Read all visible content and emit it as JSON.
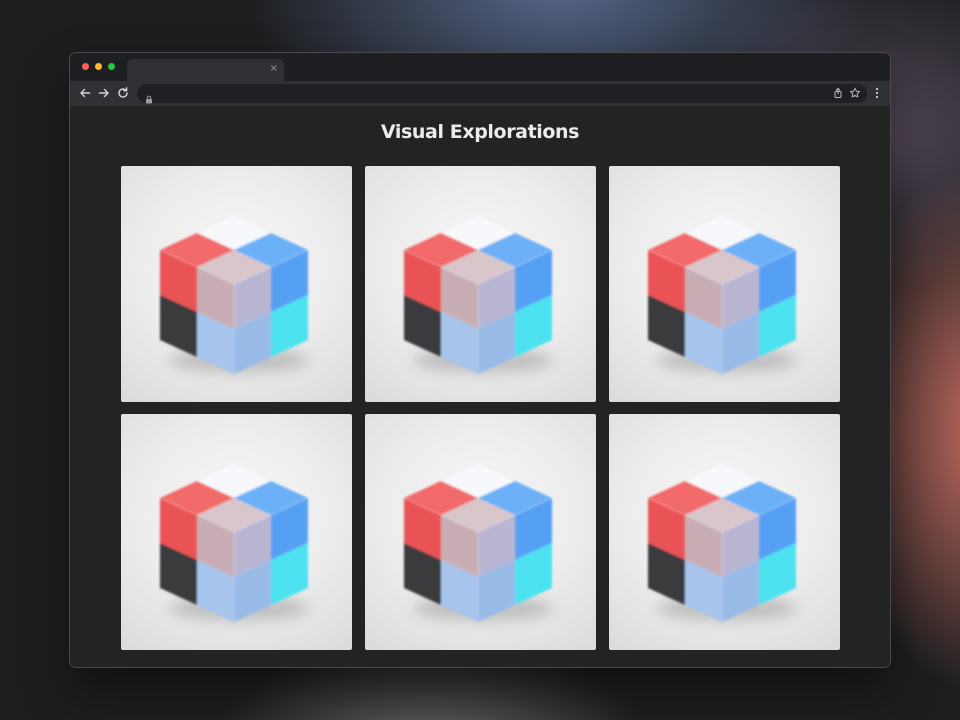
{
  "browser": {
    "tab": {
      "title": "",
      "close_glyph": "×"
    },
    "address_bar": {
      "url": ""
    },
    "traffic_lights": {
      "close": "#ff5f57",
      "minimize": "#febc2e",
      "zoom": "#28c840"
    },
    "icons": [
      "back-arrow-icon",
      "forward-arrow-icon",
      "reload-icon",
      "lock-icon",
      "share-icon",
      "star-icon",
      "more-menu-icon"
    ]
  },
  "page": {
    "title": "Visual Explorations",
    "gallery": {
      "columns": 3,
      "items": [
        {
          "name": "cube-render"
        },
        {
          "name": "cube-render"
        },
        {
          "name": "cube-render"
        },
        {
          "name": "cube-render"
        },
        {
          "name": "cube-render"
        },
        {
          "name": "cube-render"
        }
      ]
    }
  },
  "colors": {
    "page_background": "#232323",
    "title_text": "#ececec",
    "cube_red": "#ea5354",
    "cube_blue": "#56a0f4",
    "cube_white": "#f6f8fb",
    "cube_cyan": "#4ee2ef",
    "cube_dark": "#3a3b3d",
    "cube_light_blue": "#a6c4ec",
    "cube_glass": "#c8aeb4"
  }
}
